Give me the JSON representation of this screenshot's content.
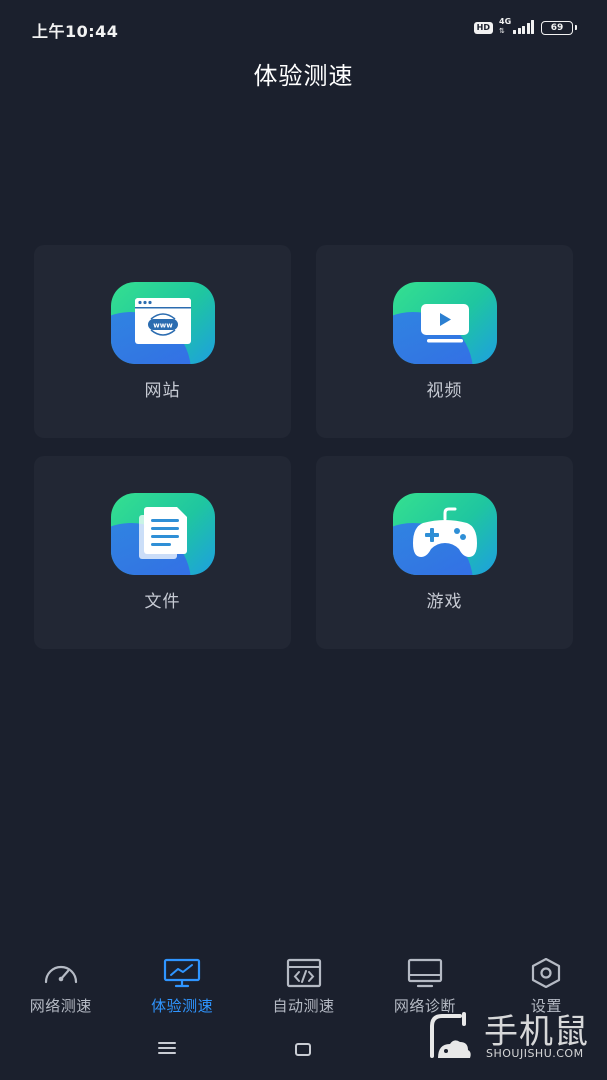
{
  "status_bar": {
    "time": "上午10:44",
    "hd": "HD",
    "network": "4G",
    "battery": "69"
  },
  "header": {
    "title": "体验测速"
  },
  "cards": [
    {
      "label": "网站",
      "icon": "website-icon"
    },
    {
      "label": "视频",
      "icon": "video-icon"
    },
    {
      "label": "文件",
      "icon": "file-icon"
    },
    {
      "label": "游戏",
      "icon": "game-icon"
    }
  ],
  "colors": {
    "background": "#1b202d",
    "card": "#222734",
    "active": "#2f95ff",
    "icon_gradient_start": "#35e08f",
    "icon_gradient_end": "#2f7dea"
  },
  "bottom_nav": {
    "items": [
      {
        "label": "网络测速",
        "icon": "speedometer-icon",
        "active": false
      },
      {
        "label": "体验测速",
        "icon": "monitor-chart-icon",
        "active": true
      },
      {
        "label": "自动测速",
        "icon": "code-window-icon",
        "active": false
      },
      {
        "label": "网络诊断",
        "icon": "monitor-icon",
        "active": false
      },
      {
        "label": "设置",
        "icon": "settings-hexagon-icon",
        "active": false
      }
    ]
  },
  "watermark": {
    "text": "手机鼠",
    "sub": "SHOUJISHU.COM"
  }
}
